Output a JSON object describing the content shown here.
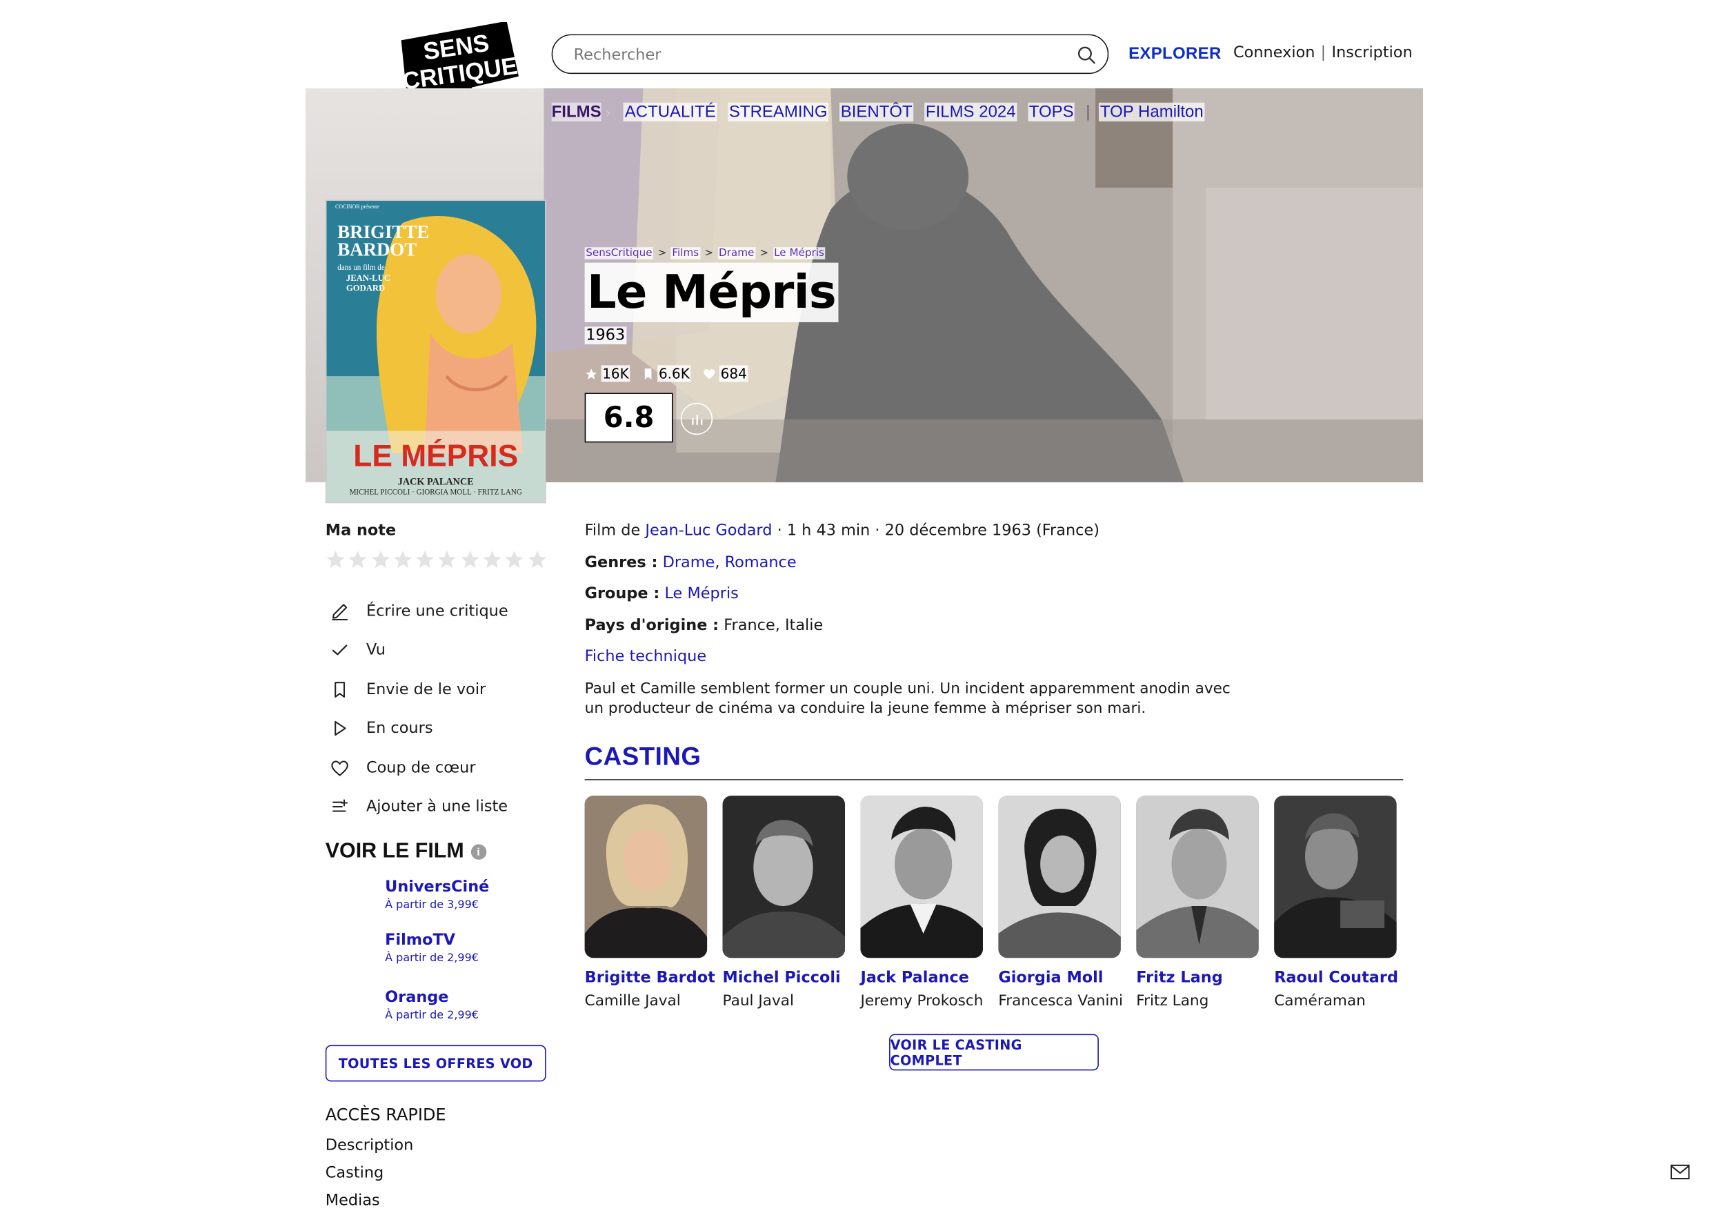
{
  "header": {
    "logo_text": "SENS CRITIQUE",
    "search_placeholder": "Rechercher",
    "explore_label": "EXPLORER",
    "login_label": "Connexion",
    "signup_label": "Inscription"
  },
  "nav": {
    "current": "FILMS",
    "items": [
      "ACTUALITÉ",
      "STREAMING",
      "BIENTÔT",
      "FILMS 2024",
      "TOPS",
      "TOP Hamilton"
    ]
  },
  "breadcrumb": [
    "SensCritique",
    "Films",
    "Drame",
    "Le Mépris"
  ],
  "film": {
    "title": "Le Mépris",
    "year": "1963",
    "ratings_count": "16K",
    "wishlist_count": "6.6K",
    "favorites_count": "684",
    "score": "6.8",
    "poster_lettering": "COCINOR présente BRIGITTE BARDOT dans un film de JEAN-LUC GODARD LE MÉPRIS d'après le roman d'ALBERTO MORAVIA JACK PALANCE MICHEL PICCOLI GIORGIA MOLL FRITZ LANG"
  },
  "sidebar": {
    "my_rating_label": "Ma note",
    "stars_count": 10,
    "actions": [
      {
        "icon": "pencil-icon",
        "label": "Écrire une critique"
      },
      {
        "icon": "check-icon",
        "label": "Vu"
      },
      {
        "icon": "bookmark-icon",
        "label": "Envie de le voir"
      },
      {
        "icon": "play-icon",
        "label": "En cours"
      },
      {
        "icon": "heart-icon",
        "label": "Coup de cœur"
      },
      {
        "icon": "add-to-list-icon",
        "label": "Ajouter à une liste"
      }
    ],
    "watch_title": "VOIR LE FILM",
    "vod": [
      {
        "name": "UniversCiné",
        "price": "À partir de 3,99€"
      },
      {
        "name": "FilmoTV",
        "price": "À partir de 2,99€"
      },
      {
        "name": "Orange",
        "price": "À partir de 2,99€"
      }
    ],
    "all_vod_label": "TOUTES LES OFFRES VOD",
    "quick_access_title": "ACCÈS RAPIDE",
    "quick_links": [
      "Description",
      "Casting",
      "Medias"
    ]
  },
  "details": {
    "film_by_prefix": "Film de",
    "director": "Jean-Luc Godard",
    "meta": "· 1 h 43 min · 20 décembre 1963 (France)",
    "genres_label": "Genres :",
    "genres": [
      "Drame",
      "Romance"
    ],
    "group_label": "Groupe :",
    "group": "Le Mépris",
    "country_label": "Pays d'origine :",
    "countries": "France, Italie",
    "tech_sheet_label": "Fiche technique",
    "synopsis": "Paul et Camille semblent former un couple uni. Un incident apparemment anodin avec un producteur de cinéma va conduire la jeune femme à mépriser son mari."
  },
  "casting": {
    "title": "CASTING",
    "members": [
      {
        "actor": "Brigitte Bardot",
        "role": "Camille Javal"
      },
      {
        "actor": "Michel Piccoli",
        "role": "Paul Javal"
      },
      {
        "actor": "Jack Palance",
        "role": "Jeremy Prokosch"
      },
      {
        "actor": "Giorgia Moll",
        "role": "Francesca Vanini"
      },
      {
        "actor": "Fritz Lang",
        "role": "Fritz Lang"
      },
      {
        "actor": "Raoul Coutard",
        "role": "Caméraman"
      }
    ],
    "full_cast_label": "VOIR LE CASTING COMPLET"
  },
  "colors": {
    "accent_blue": "#1b18b5",
    "explore_blue": "#0f2ec8",
    "nav_current": "#3a1766"
  }
}
